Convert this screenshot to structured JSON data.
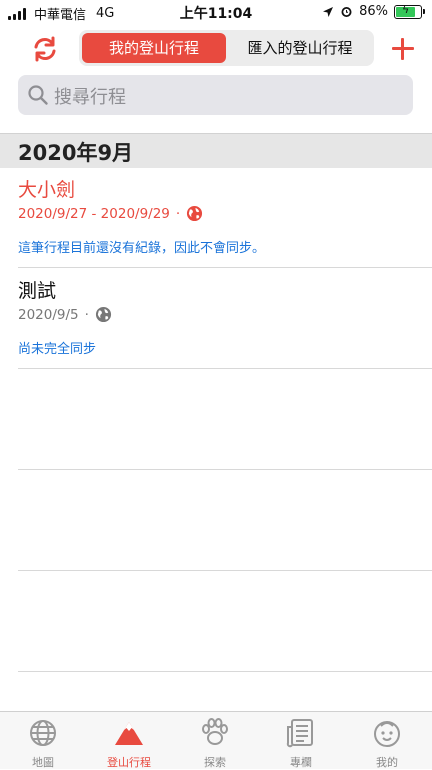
{
  "status_bar": {
    "carrier": "中華電信",
    "network": "4G",
    "time": "上午11:04",
    "battery_percent": "86%",
    "battery_level": 0.86
  },
  "header": {
    "refresh_icon": "refresh-icon",
    "segments": [
      "我的登山行程",
      "匯入的登山行程"
    ],
    "active_segment": 0,
    "add_icon": "plus-icon"
  },
  "search": {
    "placeholder": "搜尋行程",
    "icon": "search-icon"
  },
  "section": {
    "title": "2020年9月"
  },
  "trips": [
    {
      "name": "大小劍",
      "dates": "2020/9/27 - 2020/9/29",
      "separator": "·",
      "status_icon": "globe-icon",
      "note": "這筆行程目前還沒有紀錄，因此不會同步。"
    },
    {
      "name": "測試",
      "dates": "2020/9/5",
      "separator": "·",
      "status_icon": "globe-icon",
      "note": "尚未完全同步"
    }
  ],
  "tab_bar": {
    "items": [
      {
        "label": "地圖",
        "icon": "globe-icon"
      },
      {
        "label": "登山行程",
        "icon": "mountain-icon"
      },
      {
        "label": "探索",
        "icon": "paw-icon"
      },
      {
        "label": "專欄",
        "icon": "news-icon"
      },
      {
        "label": "我的",
        "icon": "face-icon"
      }
    ],
    "active_index": 1
  },
  "colors": {
    "accent": "#e84a3f",
    "link": "#1a73d9",
    "tab_inactive": "#888888"
  }
}
